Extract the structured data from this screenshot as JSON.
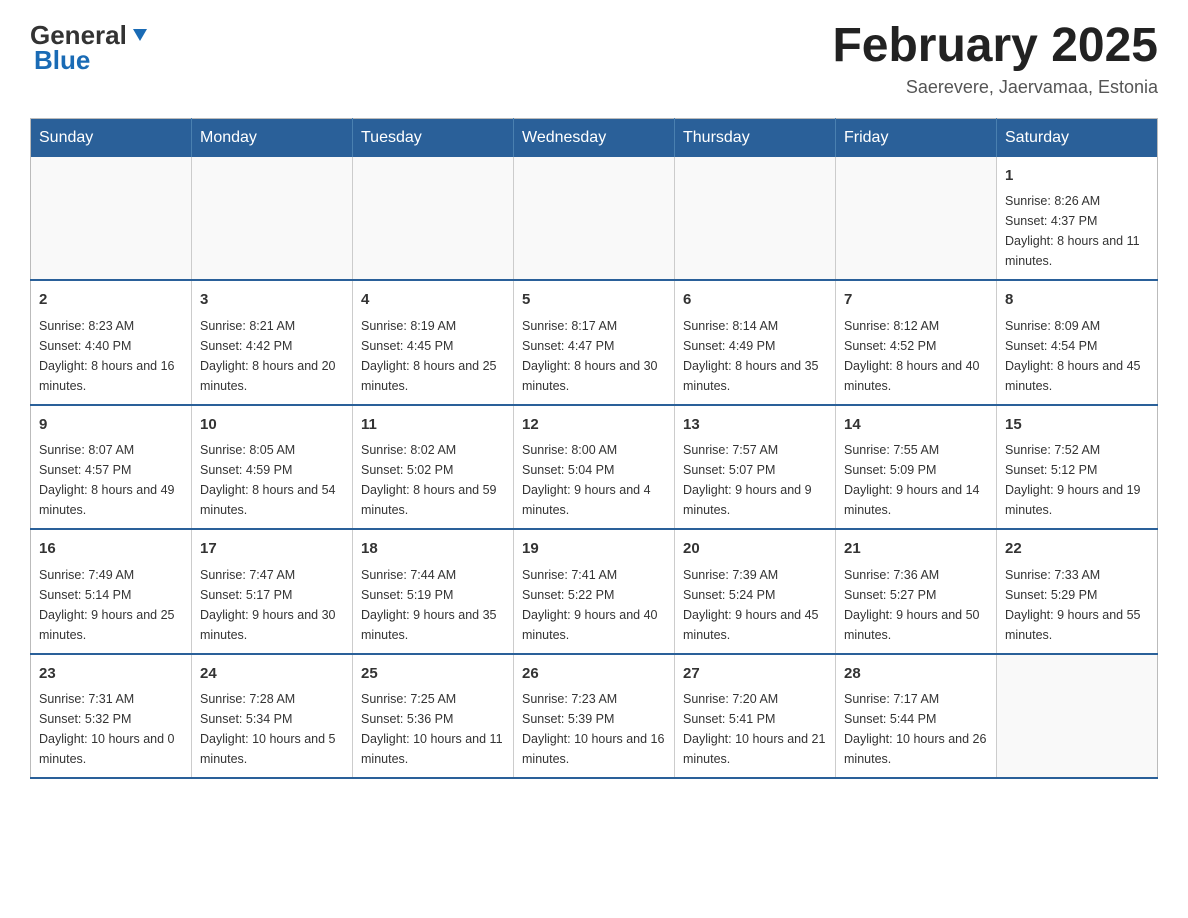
{
  "header": {
    "logo_general": "General",
    "logo_blue": "Blue",
    "month_title": "February 2025",
    "location": "Saerevere, Jaervamaa, Estonia"
  },
  "weekdays": [
    "Sunday",
    "Monday",
    "Tuesday",
    "Wednesday",
    "Thursday",
    "Friday",
    "Saturday"
  ],
  "weeks": [
    [
      {
        "day": "",
        "info": ""
      },
      {
        "day": "",
        "info": ""
      },
      {
        "day": "",
        "info": ""
      },
      {
        "day": "",
        "info": ""
      },
      {
        "day": "",
        "info": ""
      },
      {
        "day": "",
        "info": ""
      },
      {
        "day": "1",
        "info": "Sunrise: 8:26 AM\nSunset: 4:37 PM\nDaylight: 8 hours and 11 minutes."
      }
    ],
    [
      {
        "day": "2",
        "info": "Sunrise: 8:23 AM\nSunset: 4:40 PM\nDaylight: 8 hours and 16 minutes."
      },
      {
        "day": "3",
        "info": "Sunrise: 8:21 AM\nSunset: 4:42 PM\nDaylight: 8 hours and 20 minutes."
      },
      {
        "day": "4",
        "info": "Sunrise: 8:19 AM\nSunset: 4:45 PM\nDaylight: 8 hours and 25 minutes."
      },
      {
        "day": "5",
        "info": "Sunrise: 8:17 AM\nSunset: 4:47 PM\nDaylight: 8 hours and 30 minutes."
      },
      {
        "day": "6",
        "info": "Sunrise: 8:14 AM\nSunset: 4:49 PM\nDaylight: 8 hours and 35 minutes."
      },
      {
        "day": "7",
        "info": "Sunrise: 8:12 AM\nSunset: 4:52 PM\nDaylight: 8 hours and 40 minutes."
      },
      {
        "day": "8",
        "info": "Sunrise: 8:09 AM\nSunset: 4:54 PM\nDaylight: 8 hours and 45 minutes."
      }
    ],
    [
      {
        "day": "9",
        "info": "Sunrise: 8:07 AM\nSunset: 4:57 PM\nDaylight: 8 hours and 49 minutes."
      },
      {
        "day": "10",
        "info": "Sunrise: 8:05 AM\nSunset: 4:59 PM\nDaylight: 8 hours and 54 minutes."
      },
      {
        "day": "11",
        "info": "Sunrise: 8:02 AM\nSunset: 5:02 PM\nDaylight: 8 hours and 59 minutes."
      },
      {
        "day": "12",
        "info": "Sunrise: 8:00 AM\nSunset: 5:04 PM\nDaylight: 9 hours and 4 minutes."
      },
      {
        "day": "13",
        "info": "Sunrise: 7:57 AM\nSunset: 5:07 PM\nDaylight: 9 hours and 9 minutes."
      },
      {
        "day": "14",
        "info": "Sunrise: 7:55 AM\nSunset: 5:09 PM\nDaylight: 9 hours and 14 minutes."
      },
      {
        "day": "15",
        "info": "Sunrise: 7:52 AM\nSunset: 5:12 PM\nDaylight: 9 hours and 19 minutes."
      }
    ],
    [
      {
        "day": "16",
        "info": "Sunrise: 7:49 AM\nSunset: 5:14 PM\nDaylight: 9 hours and 25 minutes."
      },
      {
        "day": "17",
        "info": "Sunrise: 7:47 AM\nSunset: 5:17 PM\nDaylight: 9 hours and 30 minutes."
      },
      {
        "day": "18",
        "info": "Sunrise: 7:44 AM\nSunset: 5:19 PM\nDaylight: 9 hours and 35 minutes."
      },
      {
        "day": "19",
        "info": "Sunrise: 7:41 AM\nSunset: 5:22 PM\nDaylight: 9 hours and 40 minutes."
      },
      {
        "day": "20",
        "info": "Sunrise: 7:39 AM\nSunset: 5:24 PM\nDaylight: 9 hours and 45 minutes."
      },
      {
        "day": "21",
        "info": "Sunrise: 7:36 AM\nSunset: 5:27 PM\nDaylight: 9 hours and 50 minutes."
      },
      {
        "day": "22",
        "info": "Sunrise: 7:33 AM\nSunset: 5:29 PM\nDaylight: 9 hours and 55 minutes."
      }
    ],
    [
      {
        "day": "23",
        "info": "Sunrise: 7:31 AM\nSunset: 5:32 PM\nDaylight: 10 hours and 0 minutes."
      },
      {
        "day": "24",
        "info": "Sunrise: 7:28 AM\nSunset: 5:34 PM\nDaylight: 10 hours and 5 minutes."
      },
      {
        "day": "25",
        "info": "Sunrise: 7:25 AM\nSunset: 5:36 PM\nDaylight: 10 hours and 11 minutes."
      },
      {
        "day": "26",
        "info": "Sunrise: 7:23 AM\nSunset: 5:39 PM\nDaylight: 10 hours and 16 minutes."
      },
      {
        "day": "27",
        "info": "Sunrise: 7:20 AM\nSunset: 5:41 PM\nDaylight: 10 hours and 21 minutes."
      },
      {
        "day": "28",
        "info": "Sunrise: 7:17 AM\nSunset: 5:44 PM\nDaylight: 10 hours and 26 minutes."
      },
      {
        "day": "",
        "info": ""
      }
    ]
  ]
}
